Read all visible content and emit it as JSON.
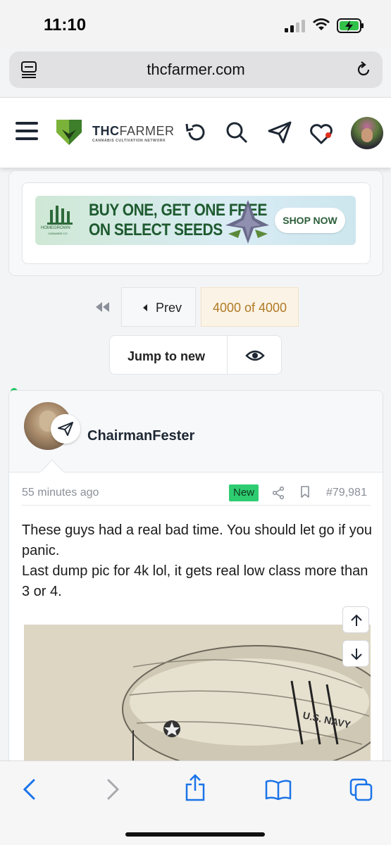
{
  "status_bar": {
    "time": "11:10"
  },
  "browser": {
    "url": "thcfarmer.com"
  },
  "site_header": {
    "logo_bold": "THC",
    "logo_light": "FARMER",
    "logo_tagline": "CANNABIS CULTIVATION NETWORK"
  },
  "ad": {
    "line1": "BUY ONE, GET ONE FREE",
    "line2": "ON SELECT SEEDS",
    "brand": "HOMEGROWN",
    "brand_sub": "CANNABIS CO",
    "cta": "SHOP NOW"
  },
  "pagination": {
    "prev_label": "Prev",
    "page_label": "4000 of 4000",
    "jump_label": "Jump to new"
  },
  "post": {
    "username": "ChairmanFester",
    "time": "55 minutes ago",
    "badge": "New",
    "number": "#79,981",
    "line1": "These guys had a real bad time. You should let go if you panic.",
    "line2": "Last dump pic for 4k lol, it gets real low class more than 3 or 4.",
    "photo_caption": "U.S. NAVY"
  },
  "colors": {
    "online": "#22c55e",
    "badge_green": "#2ecc71",
    "page_highlight": "#fbf3e6",
    "ios_blue": "#1a73e8",
    "notif_red": "#e0301e"
  }
}
